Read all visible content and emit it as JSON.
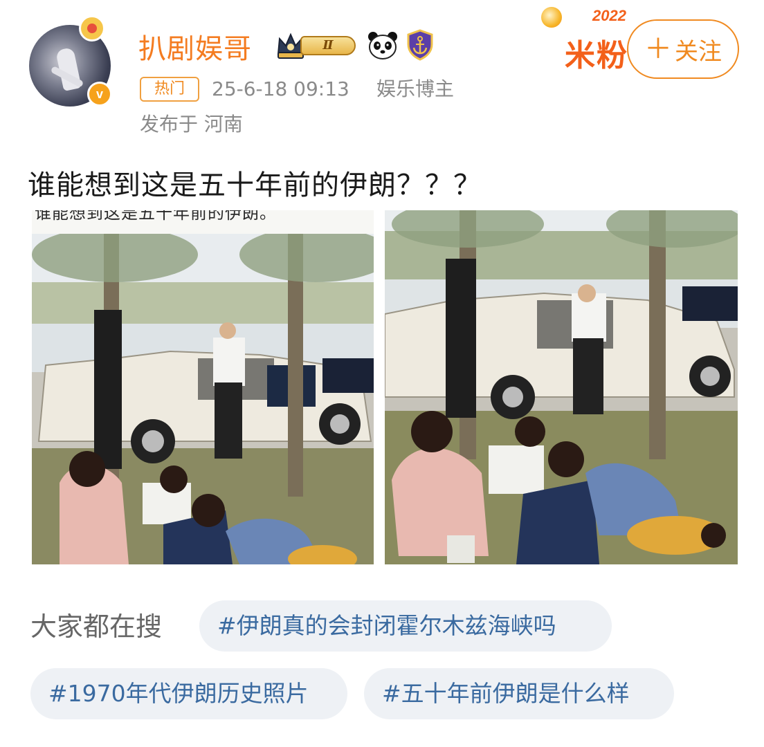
{
  "user": {
    "name": "扒剧娱哥",
    "level_badge": "Ⅱ",
    "verified_mark": "v",
    "hot_tag": "热门",
    "timestamp": "25-6-18 09:13",
    "role": "娱乐博主",
    "location": "发布于 河南"
  },
  "fan_badge": {
    "year": "2022",
    "name": "米粉"
  },
  "follow_button": {
    "plus": "＋",
    "label": "关注"
  },
  "post": {
    "text": "谁能想到这是五十年前的伊朗？？？",
    "images": [
      {
        "caption_overlay": "谁能想到这是五十年前的伊朗。"
      },
      {
        "caption_overlay": ""
      }
    ]
  },
  "hot_search": {
    "label": "大家都在搜",
    "chips": [
      "#伊朗真的会封闭霍尔木兹海峡吗",
      "#1970年代伊朗历史照片",
      "#五十年前伊朗是什么样"
    ]
  },
  "icons": {
    "avatar": "avatar-photo",
    "verified": "verified-v-icon",
    "crown": "crown-icon",
    "panda": "panda-icon",
    "shield": "shield-anchor-icon"
  },
  "colors": {
    "accent": "#f47c21",
    "meta": "#8a8a8a",
    "chip_bg": "#eef1f5",
    "chip_text": "#3a6aa0"
  }
}
